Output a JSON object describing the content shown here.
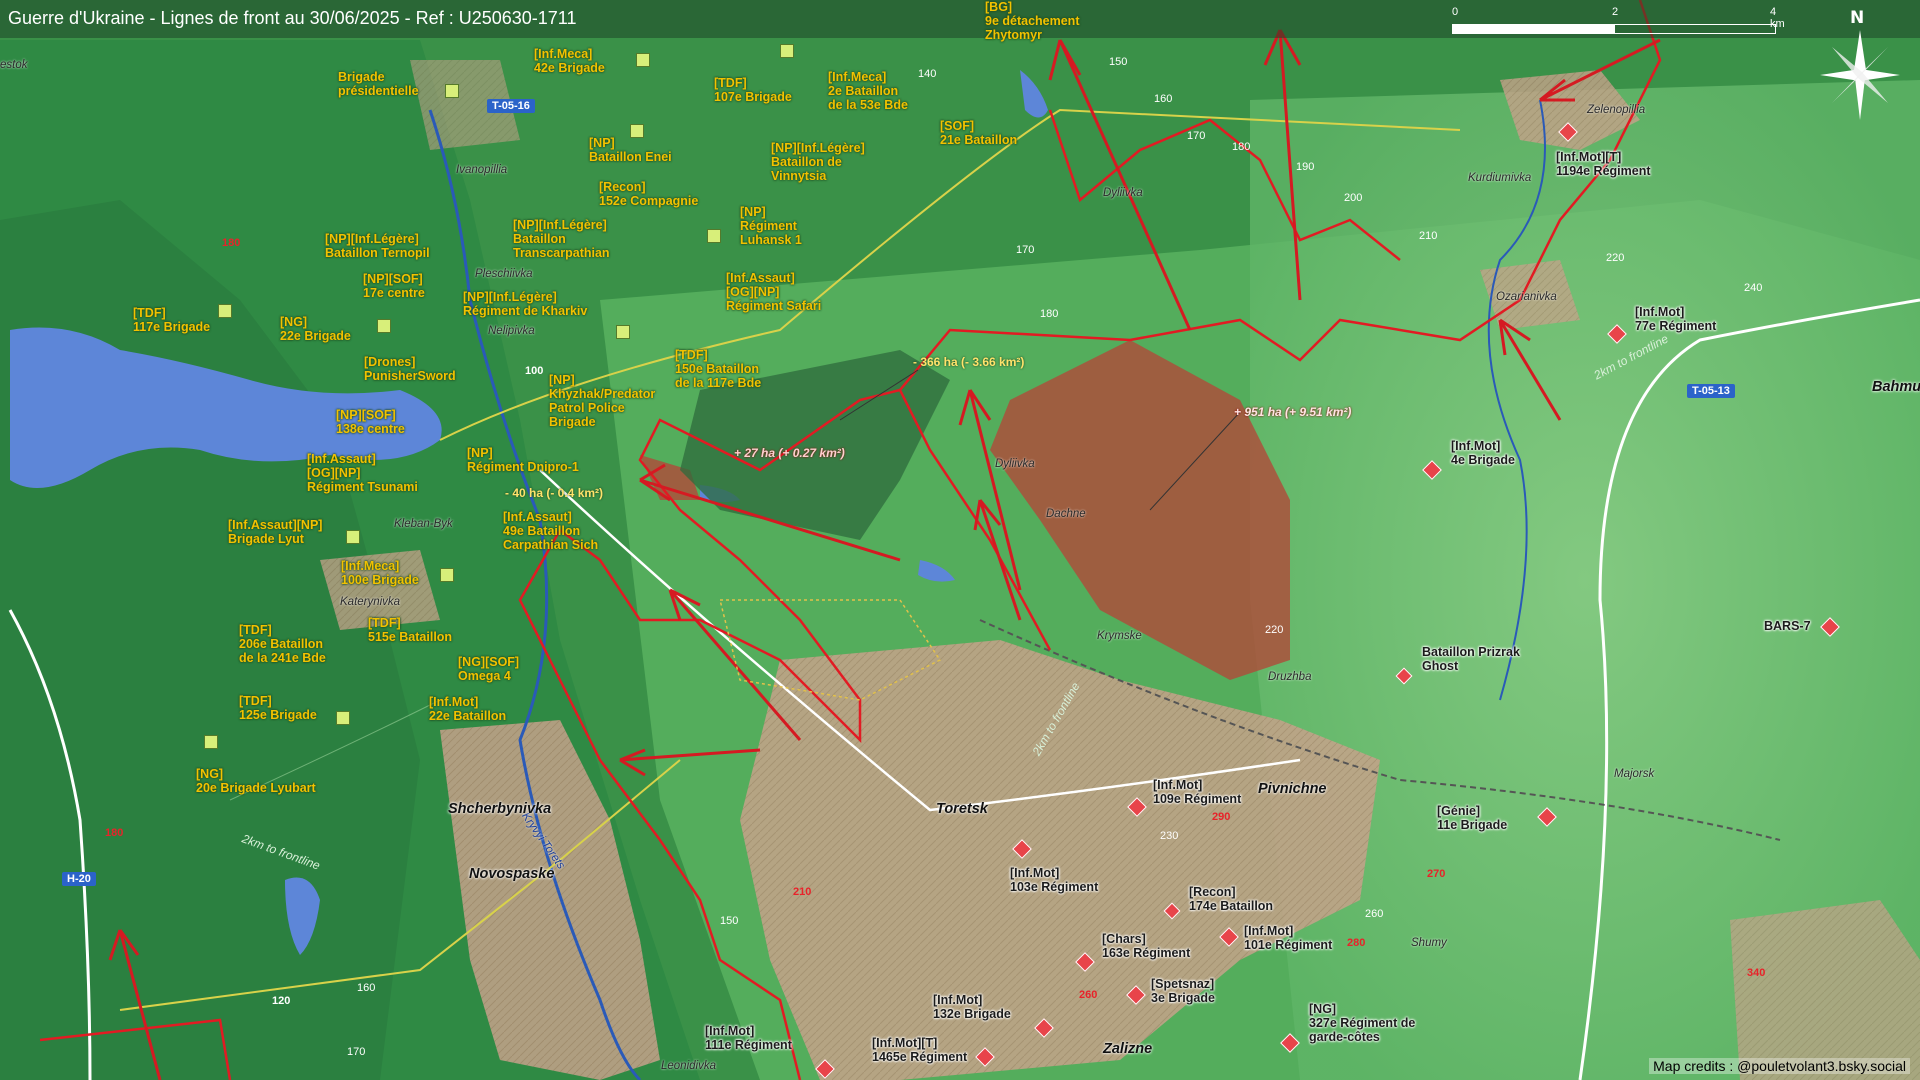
{
  "header": {
    "title": "Guerre d'Ukraine - Lignes de front au 30/06/2025 - Ref : U250630-1711"
  },
  "scale": {
    "labels": [
      "0",
      "2",
      "4 km"
    ]
  },
  "compass": {
    "label": "N"
  },
  "credits": "Map credits : @pouletvolant3.bsky.social",
  "colors": {
    "ua_unit": "#f2c200",
    "ru_unit_marker": "#e8444a",
    "frontline": "#e21b23",
    "ru_gain_zone": "#b04a3a",
    "ua_gain_zone": "#2d6b3c",
    "terrain_green": "#3f9a4e",
    "urban": "#c9a58a",
    "water": "#5d86d8"
  },
  "annotations": {
    "ua_gain": "- 366 ha (- 3.66 km²)",
    "ru_gain_main": "+ 951 ha (+ 9.51 km²)",
    "ru_gain_small": "+ 27 ha (+ 0.27 km²)",
    "ru_gain_tiny": "- 40 ha (- 0.4 km²)"
  },
  "frontline_labels": [
    "2km to frontline",
    "2km to frontline",
    "2km to frontline"
  ],
  "roads": [
    "T-05-16",
    "T-05-13",
    "H-20",
    "100",
    "120"
  ],
  "elevations": [
    "150",
    "160",
    "140",
    "170",
    "180",
    "190",
    "200",
    "210",
    "220",
    "240",
    "170",
    "180",
    "180",
    "180",
    "150",
    "160",
    "170",
    "230",
    "260",
    "120",
    "340",
    "220"
  ],
  "elevations_red": [
    "180",
    "180",
    "210",
    "290",
    "270",
    "280",
    "260",
    "340"
  ],
  "places": {
    "ivanopillia": "Ivanopillia",
    "pleschiivka": "Pleschiivka",
    "nelipivka": "Nelipivka",
    "kleban_byk": "Kleban-Byk",
    "katerynivka": "Katerynivka",
    "dyliivka_n": "Dyliivka",
    "dyliivka_s": "Dyliivka",
    "dachne": "Dachne",
    "krymske": "Krymske",
    "druzhba": "Druzhba",
    "kurdiumivka": "Kurdiumivka",
    "ozarianivka": "Ozarianivka",
    "zelenopillia": "Zelenopillia",
    "majorsk": "Majorsk",
    "shumy": "Shumy",
    "leonidivka": "Leonidivka",
    "kryvyi_torets": "Kryvyi Torets",
    "estok": "estok"
  },
  "towns": {
    "shcherbynivka": "Shcherbynivka",
    "novospaske": "Novospaske",
    "toretsk": "Toretsk",
    "pivnichne": "Pivnichne",
    "zalizne": "Zalizne",
    "bahmut": "Bahmu"
  },
  "ua_units": [
    {
      "lines": [
        "[BG]",
        "9e détachement",
        "Zhytomyr"
      ]
    },
    {
      "lines": [
        "[Inf.Meca]",
        "42e Brigade"
      ]
    },
    {
      "lines": [
        "Brigade",
        "présidentielle"
      ]
    },
    {
      "lines": [
        "[TDF]",
        "107e Brigade"
      ]
    },
    {
      "lines": [
        "[Inf.Meca]",
        "2e Bataillon",
        "de la 53e Bde"
      ]
    },
    {
      "lines": [
        "[SOF]",
        "21e Bataillon"
      ]
    },
    {
      "lines": [
        "[NP]",
        "Bataillon Enei"
      ]
    },
    {
      "lines": [
        "[NP][Inf.Légère]",
        "Bataillon de",
        "Vinnytsia"
      ]
    },
    {
      "lines": [
        "[Recon]",
        "152e Compagnie"
      ]
    },
    {
      "lines": [
        "[NP]",
        "Régiment",
        "Luhansk 1"
      ]
    },
    {
      "lines": [
        "[NP][Inf.Légère]",
        "Bataillon",
        "Transcarpathian"
      ]
    },
    {
      "lines": [
        "[NP][Inf.Légère]",
        "Bataillon Ternopil"
      ]
    },
    {
      "lines": [
        "[NP][SOF]",
        "17e centre"
      ]
    },
    {
      "lines": [
        "[Inf.Assaut]",
        "[OG][NP]",
        "Régiment Safari"
      ]
    },
    {
      "lines": [
        "[NP][Inf.Légère]",
        "Régiment de Kharkiv"
      ]
    },
    {
      "lines": [
        "[TDF]",
        "117e Brigade"
      ]
    },
    {
      "lines": [
        "[NG]",
        "22e Brigade"
      ]
    },
    {
      "lines": [
        "[Drones]",
        "PunisherSword"
      ]
    },
    {
      "lines": [
        "[TDF]",
        "150e Bataillon",
        "de la 117e Bde"
      ]
    },
    {
      "lines": [
        "[NP][SOF]",
        "138e centre"
      ]
    },
    {
      "lines": [
        "[NP]",
        "Khyzhak/Predator",
        "Patrol Police",
        "Brigade"
      ]
    },
    {
      "lines": [
        "[Inf.Assaut]",
        "[OG][NP]",
        "Régiment Tsunami"
      ]
    },
    {
      "lines": [
        "[NP]",
        "Régiment Dnipro-1"
      ]
    },
    {
      "lines": [
        "[Inf.Assaut][NP]",
        "Brigade Lyut"
      ]
    },
    {
      "lines": [
        "[Inf.Assaut]",
        "49e Bataillon",
        "Carpathian Sich"
      ]
    },
    {
      "lines": [
        "[Inf.Meca]",
        "100e Brigade"
      ]
    },
    {
      "lines": [
        "[TDF]",
        "206e Bataillon",
        "de la 241e Bde"
      ]
    },
    {
      "lines": [
        "[TDF]",
        "515e Bataillon"
      ]
    },
    {
      "lines": [
        "[NG][SOF]",
        "Omega 4"
      ]
    },
    {
      "lines": [
        "[TDF]",
        "125e Brigade"
      ]
    },
    {
      "lines": [
        "[Inf.Mot]",
        "22e Bataillon"
      ]
    },
    {
      "lines": [
        "[NG]",
        "20e Brigade Lyubart"
      ]
    }
  ],
  "ru_units": [
    {
      "lines": [
        "[Inf.Mot][T]",
        "1194e Régiment"
      ]
    },
    {
      "lines": [
        "[Inf.Mot]",
        "77e Régiment"
      ]
    },
    {
      "lines": [
        "[Inf.Mot]",
        "4e Brigade"
      ]
    },
    {
      "lines": [
        "BARS-7"
      ]
    },
    {
      "lines": [
        "Bataillon Prizrak",
        "Ghost"
      ]
    },
    {
      "lines": [
        "[Génie]",
        "11e Brigade"
      ]
    },
    {
      "lines": [
        "[Inf.Mot]",
        "109e Régiment"
      ]
    },
    {
      "lines": [
        "[Inf.Mot]",
        "103e Régiment"
      ]
    },
    {
      "lines": [
        "[Recon]",
        "174e Bataillon"
      ]
    },
    {
      "lines": [
        "[Chars]",
        "163e Régiment"
      ]
    },
    {
      "lines": [
        "[Inf.Mot]",
        "101e Régiment"
      ]
    },
    {
      "lines": [
        "[Inf.Mot]",
        "132e Brigade"
      ]
    },
    {
      "lines": [
        "[Spetsnaz]",
        "3e Brigade"
      ]
    },
    {
      "lines": [
        "[NG]",
        "327e Régiment de",
        "garde-côtes"
      ]
    },
    {
      "lines": [
        "[Inf.Mot]",
        "111e Régiment"
      ]
    },
    {
      "lines": [
        "[Inf.Mot][T]",
        "1465e Régiment"
      ]
    }
  ]
}
